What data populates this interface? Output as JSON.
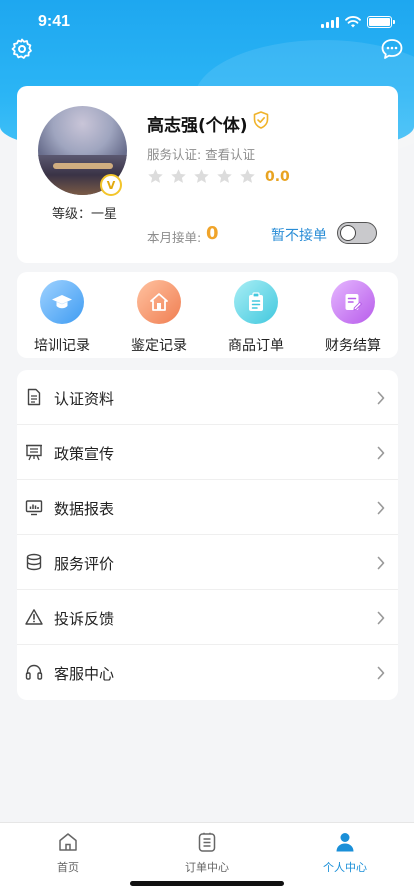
{
  "status_bar": {
    "time": "9:41"
  },
  "profile": {
    "name": "高志强(个体)",
    "certification": "服务认证: 查看认证",
    "rating": "0.0",
    "level": "等级：一星",
    "badge_letter": "V",
    "orders_label": "本月接单:",
    "orders_count": "0",
    "accept_label": "暂不接单",
    "accepting": false
  },
  "quick_actions": [
    {
      "label": "培训记录",
      "icon": "graduation-cap-icon"
    },
    {
      "label": "鉴定记录",
      "icon": "house-icon"
    },
    {
      "label": "商品订单",
      "icon": "clipboard-icon"
    },
    {
      "label": "财务结算",
      "icon": "edit-document-icon"
    }
  ],
  "menu": [
    {
      "label": "认证资料",
      "icon": "document-icon"
    },
    {
      "label": "政策宣传",
      "icon": "megaphone-icon"
    },
    {
      "label": "数据报表",
      "icon": "chart-monitor-icon"
    },
    {
      "label": "服务评价",
      "icon": "database-icon"
    },
    {
      "label": "投诉反馈",
      "icon": "warning-icon"
    },
    {
      "label": "客服中心",
      "icon": "headset-icon"
    }
  ],
  "tabs": [
    {
      "label": "首页",
      "icon": "home-icon",
      "active": false
    },
    {
      "label": "订单中心",
      "icon": "order-list-icon",
      "active": false
    },
    {
      "label": "个人中心",
      "icon": "person-icon",
      "active": true
    }
  ],
  "colors": {
    "primary": "#1ea7f0",
    "accent_orange": "#f0a42a",
    "link_blue": "#2a8dd6",
    "active_tab": "#1a8fd8"
  }
}
